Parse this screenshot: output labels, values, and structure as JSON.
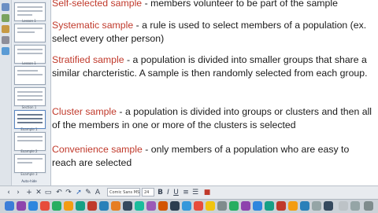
{
  "slides": [
    {
      "label": ""
    },
    {
      "label": "Lesson 1"
    },
    {
      "label": ""
    },
    {
      "label": ""
    },
    {
      "label": "Lesson 1"
    },
    {
      "label": ""
    },
    {
      "label": "Section 1"
    },
    {
      "label": "Example 1"
    },
    {
      "label": "Example 2"
    },
    {
      "label": "Example 3"
    }
  ],
  "panel_footer": "Auto-hide",
  "definitions": [
    {
      "term": "Self-selected sample",
      "text": " - members volunteer to be part of the sample"
    },
    {
      "term": "Systematic sample",
      "text": " - a rule is used to select members of a population (ex. select every other person)"
    },
    {
      "term": "Stratified sample",
      "text": " - a population is divided into smaller groups that share a similar charcteristic. A sample is then randomly selected from each group."
    },
    {
      "term": "Cluster sample",
      "text": " - a population is divided into groups or clusters and then all of the members in one or more of the clusters is selected"
    },
    {
      "term": "Convenience sample",
      "text": " - only members of a population who are easy to reach are selected"
    }
  ],
  "toolbar": {
    "font_name": "Comic Sans MS",
    "font_size": "24",
    "bold": "B",
    "italic": "I",
    "underline": "U"
  },
  "colors": {
    "term": "#c0392b",
    "text": "#1a1a1a",
    "panel_bg": "#e9edf2",
    "toolbar_bg": "#e8ebef"
  }
}
